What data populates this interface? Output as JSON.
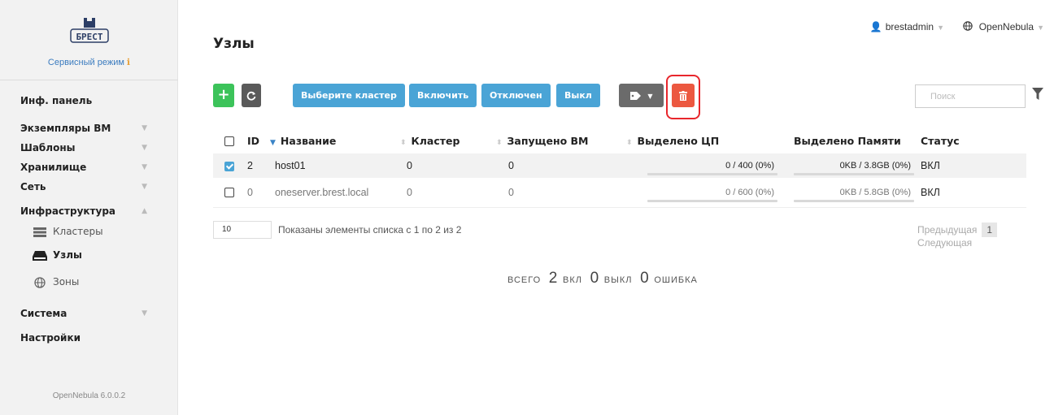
{
  "sidebar": {
    "logo_text": "БРЕСТ",
    "mode": "Сервисный режим",
    "menu": {
      "dashboard": "Инф. панель",
      "vms": "Экземпляры ВМ",
      "templates": "Шаблоны",
      "storage": "Хранилище",
      "network": "Сеть",
      "infrastructure": "Инфраструктура",
      "clusters": "Кластеры",
      "hosts": "Узлы",
      "zones": "Зоны",
      "system": "Система",
      "settings": "Настройки"
    },
    "version": "OpenNebula 6.0.0.2"
  },
  "header": {
    "title": "Узлы",
    "user": "brestadmin",
    "zone": "OpenNebula"
  },
  "toolbar": {
    "add": "+",
    "select_cluster": "Выберите кластер",
    "enable": "Включить",
    "disable": "Отключен",
    "off": "Выкл",
    "search_placeholder": "Поиск"
  },
  "table": {
    "columns": [
      "ID",
      "Название",
      "Кластер",
      "Запущено ВМ",
      "Выделено ЦП",
      "Выделено Памяти",
      "Статус"
    ],
    "rows": [
      {
        "checked": true,
        "id": "2",
        "name": "host01",
        "cluster": "0",
        "vms": "0",
        "cpu": "0 / 400 (0%)",
        "mem": "0KB / 3.8GB (0%)",
        "status": "ВКЛ"
      },
      {
        "checked": false,
        "id": "0",
        "name": "oneserver.brest.local",
        "cluster": "0",
        "vms": "0",
        "cpu": "0 / 600 (0%)",
        "mem": "0KB / 5.8GB (0%)",
        "status": "ВКЛ"
      }
    ]
  },
  "footer": {
    "page_size": "10",
    "showing": "Показаны элементы списка с 1 по 2 из 2",
    "prev": "Предыдущая",
    "page": "1",
    "next": "Следующая"
  },
  "summary": {
    "total_label": "ВСЕГО",
    "total": "2",
    "on_label": "ВКЛ",
    "on": "0",
    "off_label": "ВЫКЛ",
    "error": "0",
    "error_label": "ОШИБКА"
  },
  "colors": {
    "green": "#3cc35a",
    "blue": "#4aa4d6",
    "red": "#ec5840",
    "highlight": "#e8262c"
  }
}
